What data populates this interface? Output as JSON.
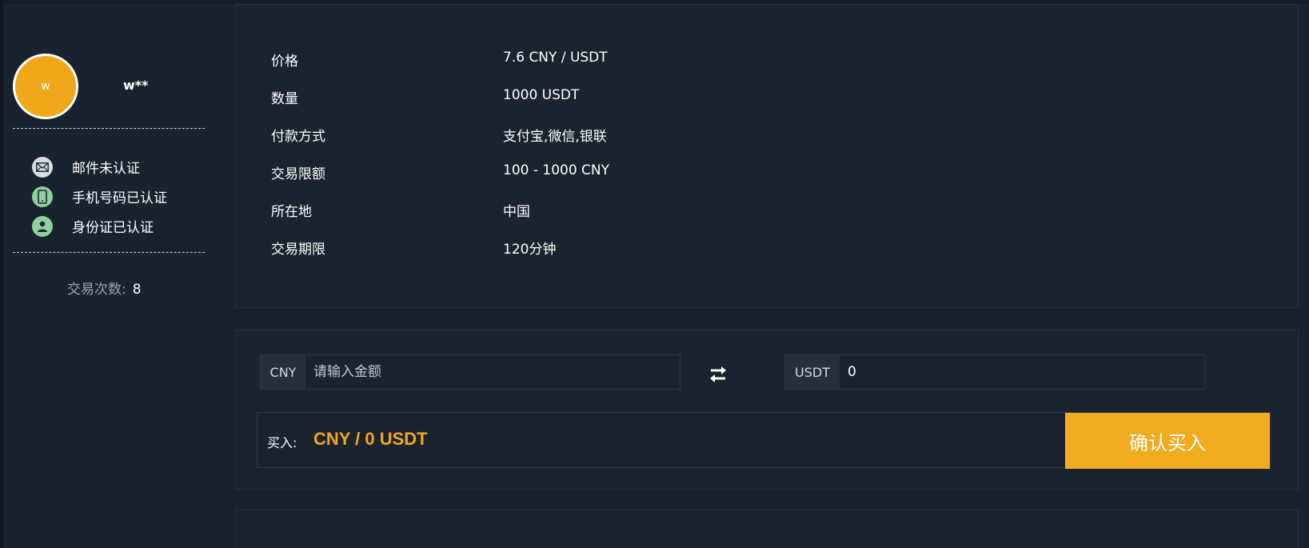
{
  "user": {
    "avatar_letter": "w",
    "name": "w**",
    "avatar_color": "#f0a81a"
  },
  "verifications": [
    {
      "icon": "envelope-icon",
      "label": "邮件未认证",
      "verified": false
    },
    {
      "icon": "phone-icon",
      "label": "手机号码已认证",
      "verified": true
    },
    {
      "icon": "person-icon",
      "label": "身份证已认证",
      "verified": true
    }
  ],
  "trade_count": {
    "label": "交易次数:",
    "value": "8"
  },
  "info": [
    {
      "key": "价格",
      "value": "7.6 CNY / USDT"
    },
    {
      "key": "数量",
      "value": "1000 USDT"
    },
    {
      "key": "付款方式",
      "value": "支付宝,微信,银联"
    },
    {
      "key": "交易限额",
      "value": "100 - 1000 CNY"
    },
    {
      "key": "所在地",
      "value": "中国"
    },
    {
      "key": "交易期限",
      "value": "120分钟"
    }
  ],
  "trade": {
    "cny_prefix": "CNY",
    "cny_placeholder": "请输入金额",
    "cny_value": "",
    "usdt_prefix": "USDT",
    "usdt_value": "0",
    "buy_label": "买入:",
    "buy_amount": "CNY / 0 USDT",
    "confirm_label": "确认买入"
  },
  "colors": {
    "accent": "#f0a81a",
    "background": "#19222f",
    "verified_green": "#8fd19a"
  }
}
